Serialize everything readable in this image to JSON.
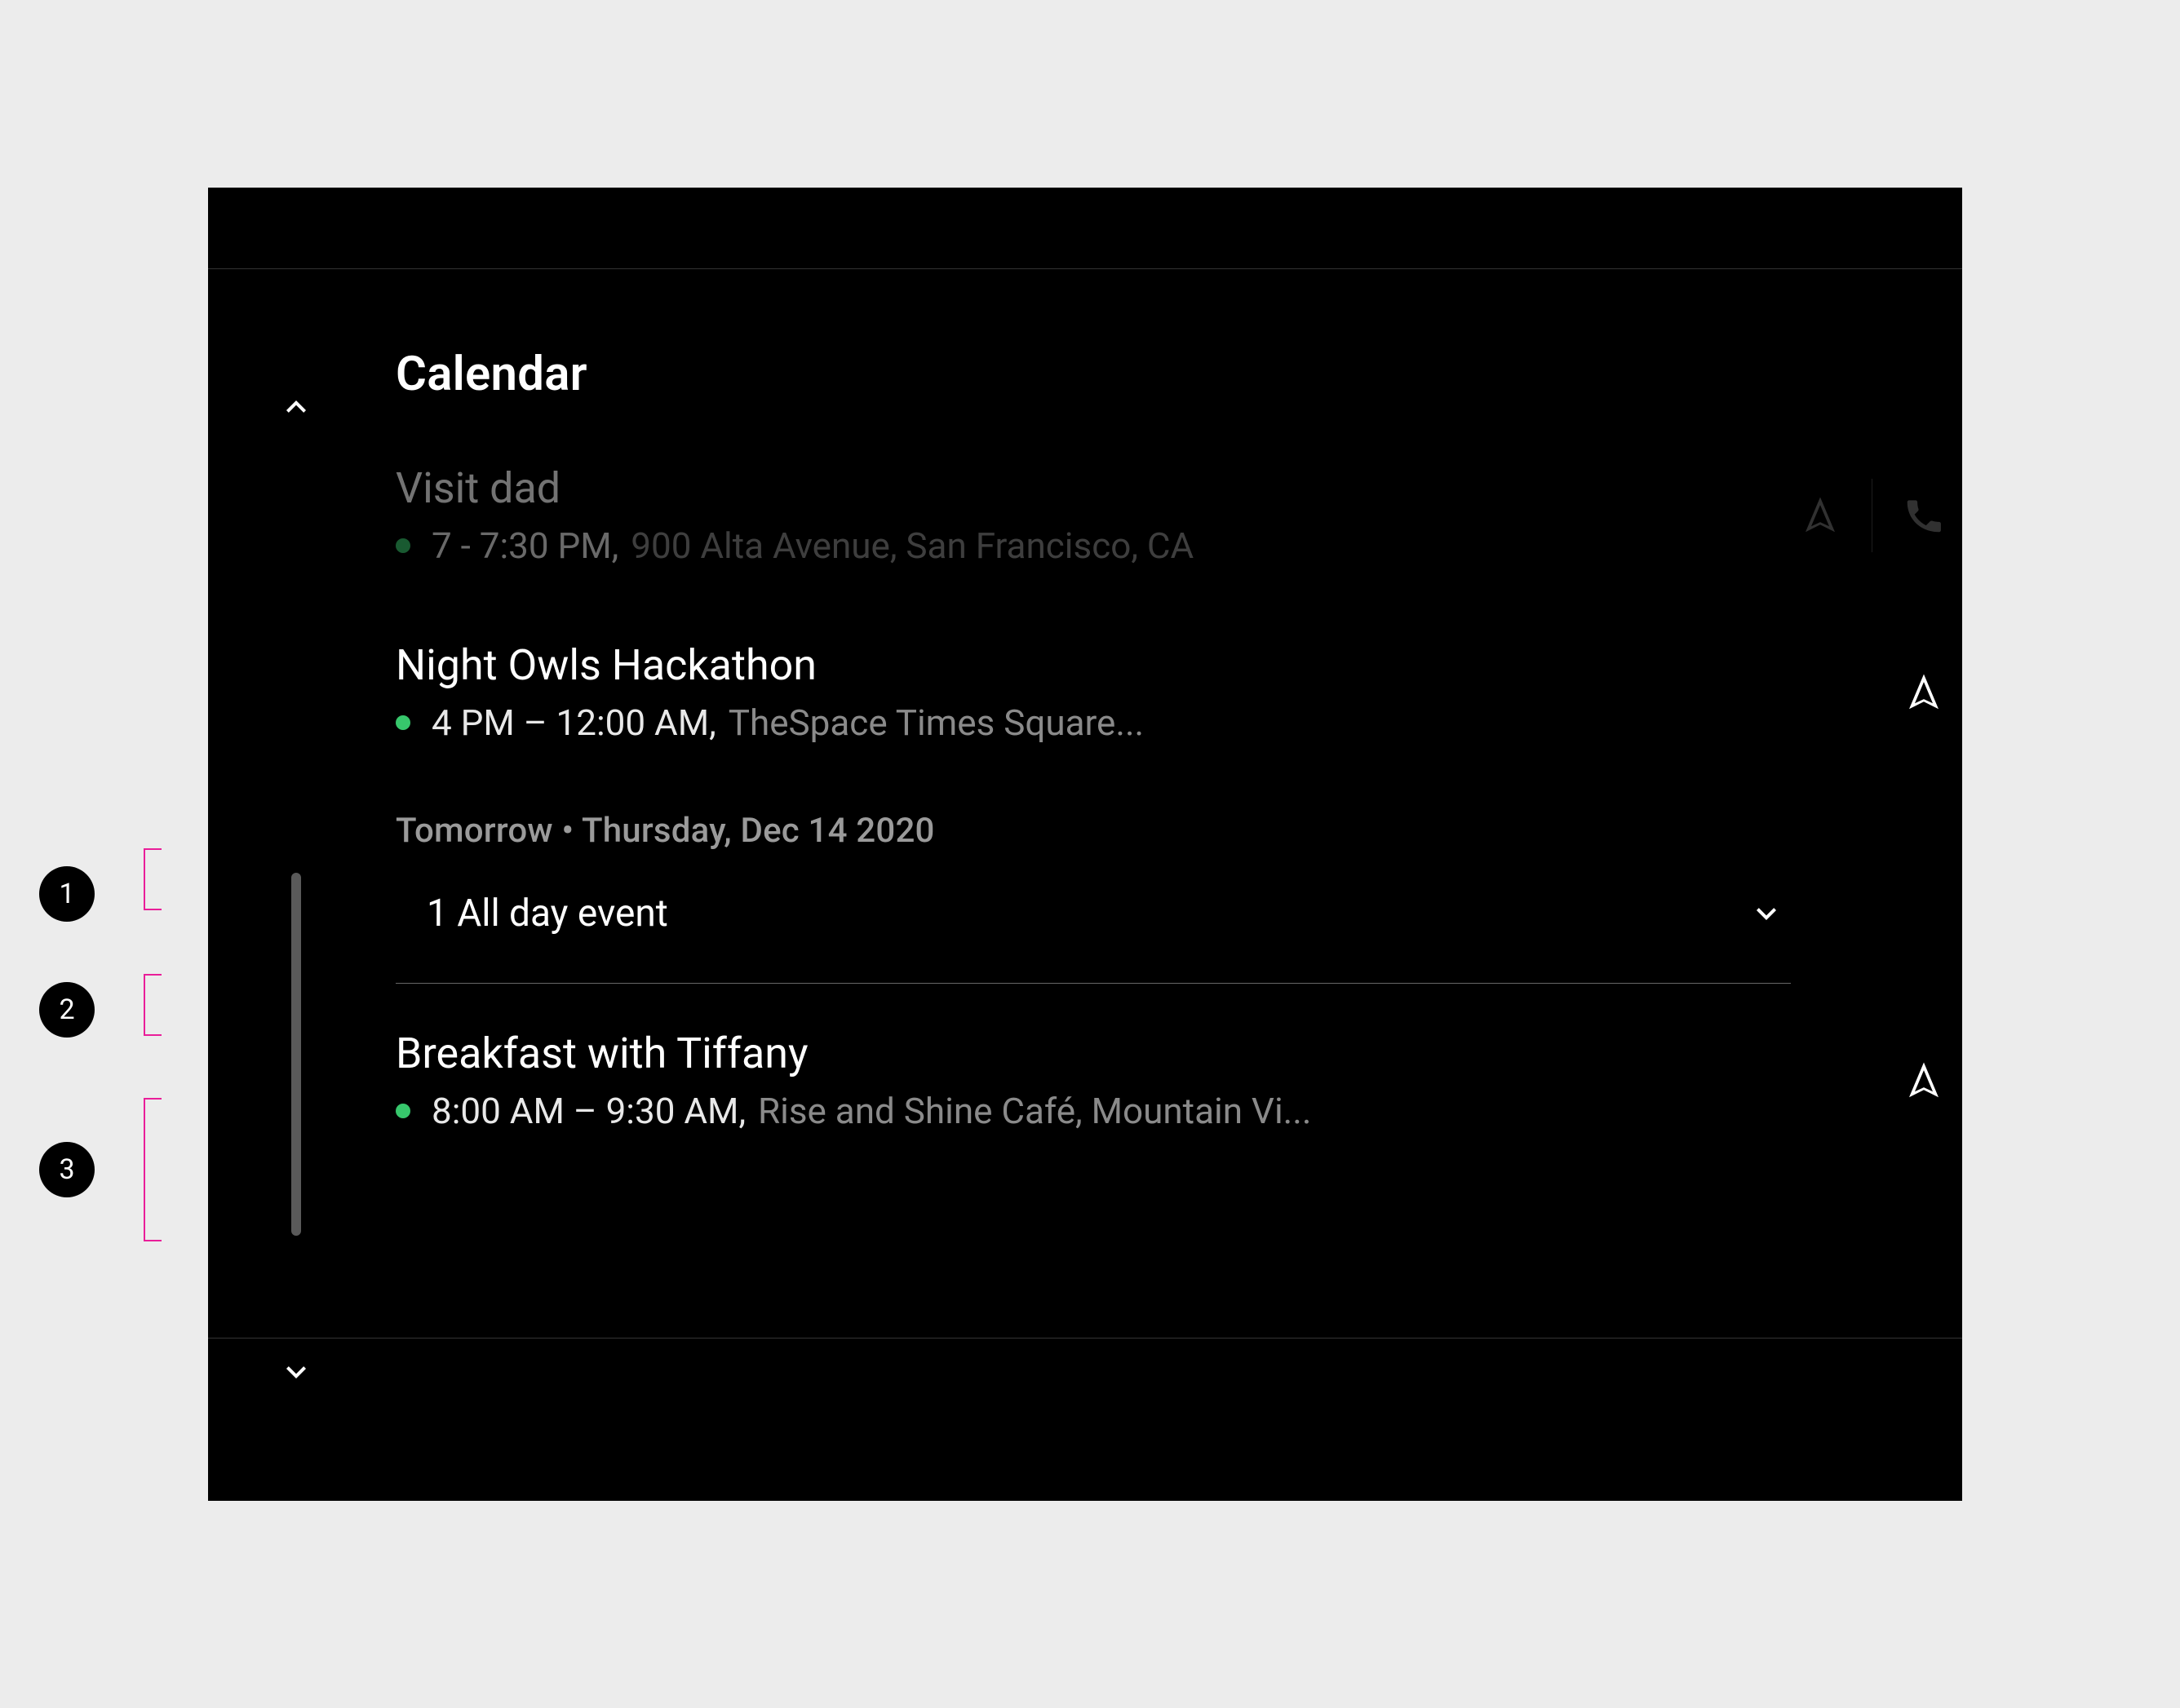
{
  "page": {
    "title": "Calendar"
  },
  "events": [
    {
      "title": "Visit dad",
      "time": "7 - 7:30 PM,",
      "location": "900 Alta Avenue, San Francisco, CA",
      "dim": true,
      "actions": [
        "navigate",
        "call"
      ]
    },
    {
      "title": "Night Owls Hackathon",
      "time": "4 PM – 12:00 AM,",
      "location": "TheSpace Times Square...",
      "dim": false,
      "actions": [
        "navigate"
      ]
    }
  ],
  "section": {
    "label": "Tomorrow • Thursday, Dec 14 2020"
  },
  "allday": {
    "label": "1 All day event"
  },
  "tomorrow_events": [
    {
      "title": "Breakfast with Tiffany",
      "time": "8:00 AM – 9:30 AM,",
      "location": "Rise and Shine Café, Mountain Vi...",
      "actions": [
        "navigate"
      ]
    }
  ],
  "annotations": [
    {
      "n": "1"
    },
    {
      "n": "2"
    },
    {
      "n": "3"
    }
  ]
}
